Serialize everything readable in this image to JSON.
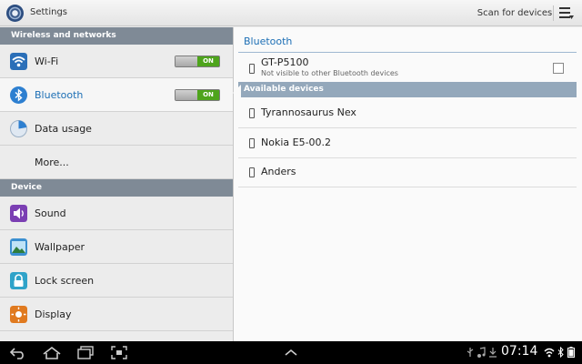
{
  "actionbar": {
    "title": "Settings",
    "scan_label": "Scan for devices"
  },
  "sidebar": {
    "sections": [
      {
        "header": "Wireless and networks",
        "items": [
          {
            "label": "Wi-Fi",
            "icon": "wifi-icon",
            "toggle": "ON"
          },
          {
            "label": "Bluetooth",
            "icon": "bluetooth-icon",
            "toggle": "ON",
            "selected": true
          },
          {
            "label": "Data usage",
            "icon": "data-usage-icon"
          },
          {
            "label": "More...",
            "icon": null
          }
        ]
      },
      {
        "header": "Device",
        "items": [
          {
            "label": "Sound",
            "icon": "sound-icon"
          },
          {
            "label": "Wallpaper",
            "icon": "wallpaper-icon"
          },
          {
            "label": "Lock screen",
            "icon": "lock-icon"
          },
          {
            "label": "Display",
            "icon": "display-icon"
          }
        ]
      }
    ]
  },
  "detail": {
    "title": "Bluetooth",
    "own_device": {
      "name": "GT-P5100",
      "subtitle": "Not visible to other Bluetooth devices",
      "visible_checked": false
    },
    "available_header": "Available devices",
    "available_devices": [
      {
        "name": "Tyrannosaurus Nex"
      },
      {
        "name": "Nokia E5-00.2"
      },
      {
        "name": "Anders"
      }
    ]
  },
  "statusbar": {
    "time": "07:14"
  },
  "colors": {
    "accent": "#1d6fb5",
    "toggle_on": "#4ea41c",
    "section_header": "#7f8a96",
    "available_header": "#94a8bb"
  }
}
